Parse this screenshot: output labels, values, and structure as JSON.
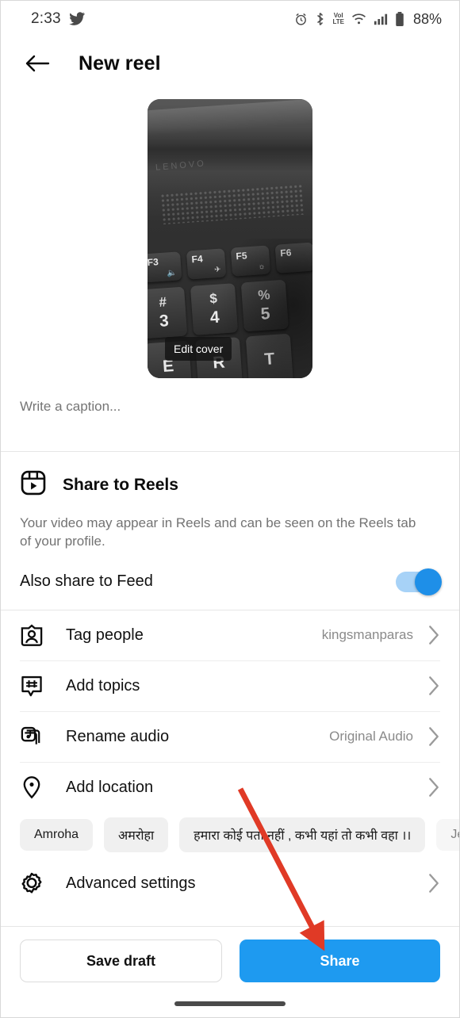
{
  "status_bar": {
    "time": "2:33",
    "app_icon": "twitter-bird-icon",
    "icons": [
      "alarm-icon",
      "bluetooth-icon",
      "volte-icon",
      "wifi-icon",
      "signal-icon",
      "battery-icon"
    ],
    "volte_top": "VoI",
    "volte_bottom": "LTE",
    "battery_percent": "88%"
  },
  "header": {
    "back_icon": "back-arrow-icon",
    "title": "New reel"
  },
  "media": {
    "edit_cover_label": "Edit cover",
    "keyboard": {
      "fkeys": [
        {
          "label": "F3",
          "sub": "⬚"
        },
        {
          "label": "F4",
          "sub": "✈"
        },
        {
          "label": "F5",
          "sub": "☀"
        },
        {
          "label": "F6",
          "sub": ""
        }
      ],
      "numkeys": [
        {
          "top": "#",
          "bottom": "3"
        },
        {
          "top": "$",
          "bottom": "4"
        },
        {
          "top": "%",
          "bottom": "5"
        }
      ],
      "letterkeys": [
        "E",
        "R",
        "T"
      ],
      "brand": "LENOVO"
    }
  },
  "caption": {
    "placeholder": "Write a caption...",
    "value": ""
  },
  "reels": {
    "icon": "reels-icon",
    "title": "Share to Reels",
    "description": "Your video may appear in Reels and can be seen on the Reels tab of your profile.",
    "feed_toggle_label": "Also share to Feed",
    "feed_toggle_on": true
  },
  "options": [
    {
      "icon": "tag-people-icon",
      "label": "Tag people",
      "value": "kingsmanparas",
      "chevron": "chevron-right-icon"
    },
    {
      "icon": "hashtag-icon",
      "label": "Add topics",
      "value": "",
      "chevron": "chevron-right-icon"
    },
    {
      "icon": "audio-note-icon",
      "label": "Rename audio",
      "value": "Original Audio",
      "chevron": "chevron-right-icon"
    },
    {
      "icon": "location-pin-icon",
      "label": "Add location",
      "value": "",
      "chevron": "chevron-right-icon"
    },
    {
      "icon": "gear-icon",
      "label": "Advanced settings",
      "value": "",
      "chevron": "chevron-right-icon"
    }
  ],
  "location_chips": [
    "Amroha",
    "अमरोहा",
    "हमारा कोई पता नहीं , कभी यहां तो कभी वहा ।।",
    "Jewelle"
  ],
  "actions": {
    "save_draft_label": "Save draft",
    "share_label": "Share"
  },
  "annotation": {
    "arrow_color": "#E03A26",
    "arrow_name": "red-pointer-arrow"
  },
  "colors": {
    "accent_blue": "#1E9AF0",
    "toggle_track": "#A7D2F7",
    "toggle_knob": "#1E8FE8",
    "chip_bg": "#F0F0F0"
  }
}
